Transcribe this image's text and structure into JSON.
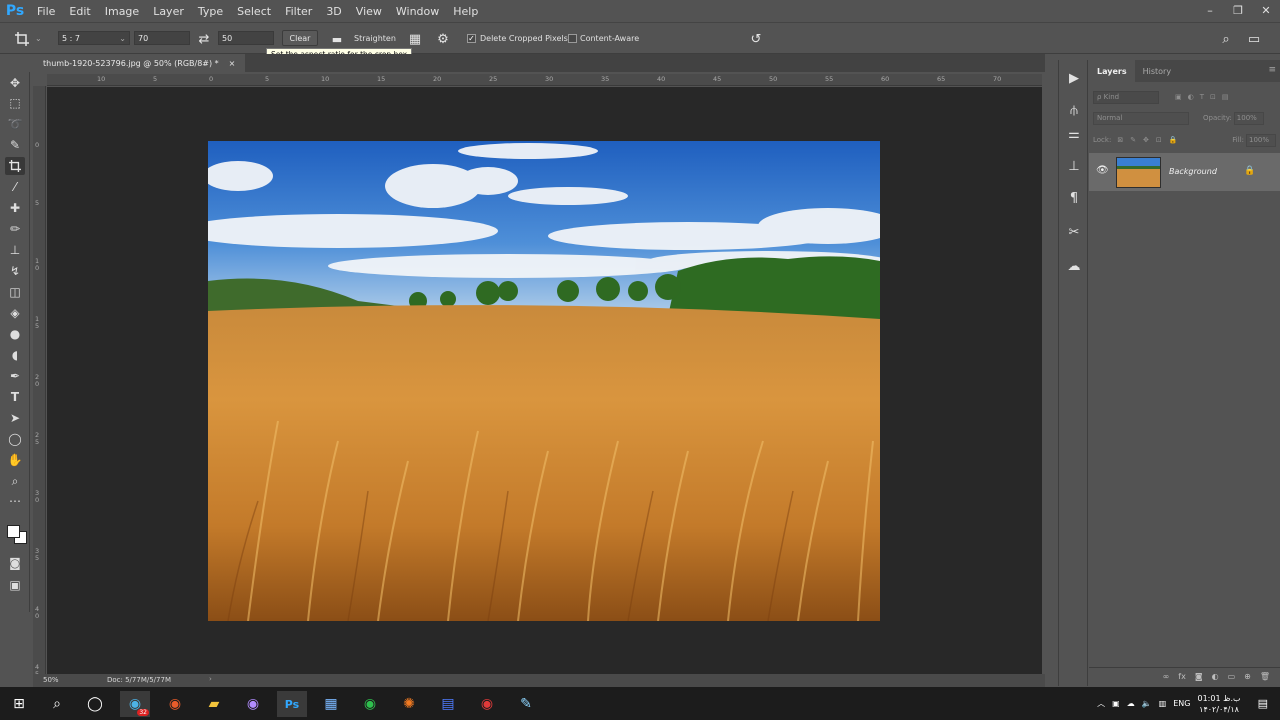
{
  "app": {
    "logo": "Ps"
  },
  "menu": [
    "File",
    "Edit",
    "Image",
    "Layer",
    "Type",
    "Select",
    "Filter",
    "3D",
    "View",
    "Window",
    "Help"
  ],
  "window_controls": {
    "minimize": "–",
    "restore": "❐",
    "close": "✕"
  },
  "options": {
    "ratio_preset": "5 : 7",
    "width_value": "70",
    "height_value": "50",
    "clear_label": "Clear",
    "straighten_label": "Straighten",
    "delete_cropped_label": "Delete Cropped Pixels",
    "delete_cropped_checked": true,
    "content_aware_label": "Content-Aware",
    "content_aware_checked": false,
    "tooltip": "Set the aspect ratio for the crop box"
  },
  "document": {
    "tab_title": "thumb-1920-523796.jpg @ 50% (RGB/8#) *",
    "close": "×",
    "zoom": "50%",
    "doc_info": "Doc: 5/77M/5/77M"
  },
  "rulers": {
    "top_ticks": [
      "10",
      "5",
      "0",
      "5",
      "10",
      "15",
      "20",
      "25",
      "30",
      "35",
      "40",
      "45",
      "50",
      "55",
      "60",
      "65",
      "70"
    ],
    "left_ticks": [
      "0",
      "5",
      "1 0",
      "1 5",
      "2 0",
      "2 5",
      "3 0",
      "3 5",
      "4 0",
      "4 5"
    ]
  },
  "layers_panel": {
    "tabs": [
      "Layers",
      "History"
    ],
    "kind_placeholder": "ρ Kind",
    "blend_mode": "Normal",
    "opacity_label": "Opacity:",
    "opacity_value": "100%",
    "lock_label": "Lock:",
    "fill_label": "Fill:",
    "fill_value": "100%",
    "layers": [
      {
        "name": "Background",
        "visible": true,
        "locked": true
      }
    ],
    "footer_icons": [
      "link-icon",
      "fx-icon",
      "mask-icon",
      "adjustment-icon",
      "group-icon",
      "new-layer-icon",
      "trash-icon"
    ]
  },
  "taskbar": {
    "badge": "32",
    "lang": "ENG",
    "time": "01:01 ب.ظ",
    "date": "۱۴۰۲/۰۴/۱۸"
  }
}
